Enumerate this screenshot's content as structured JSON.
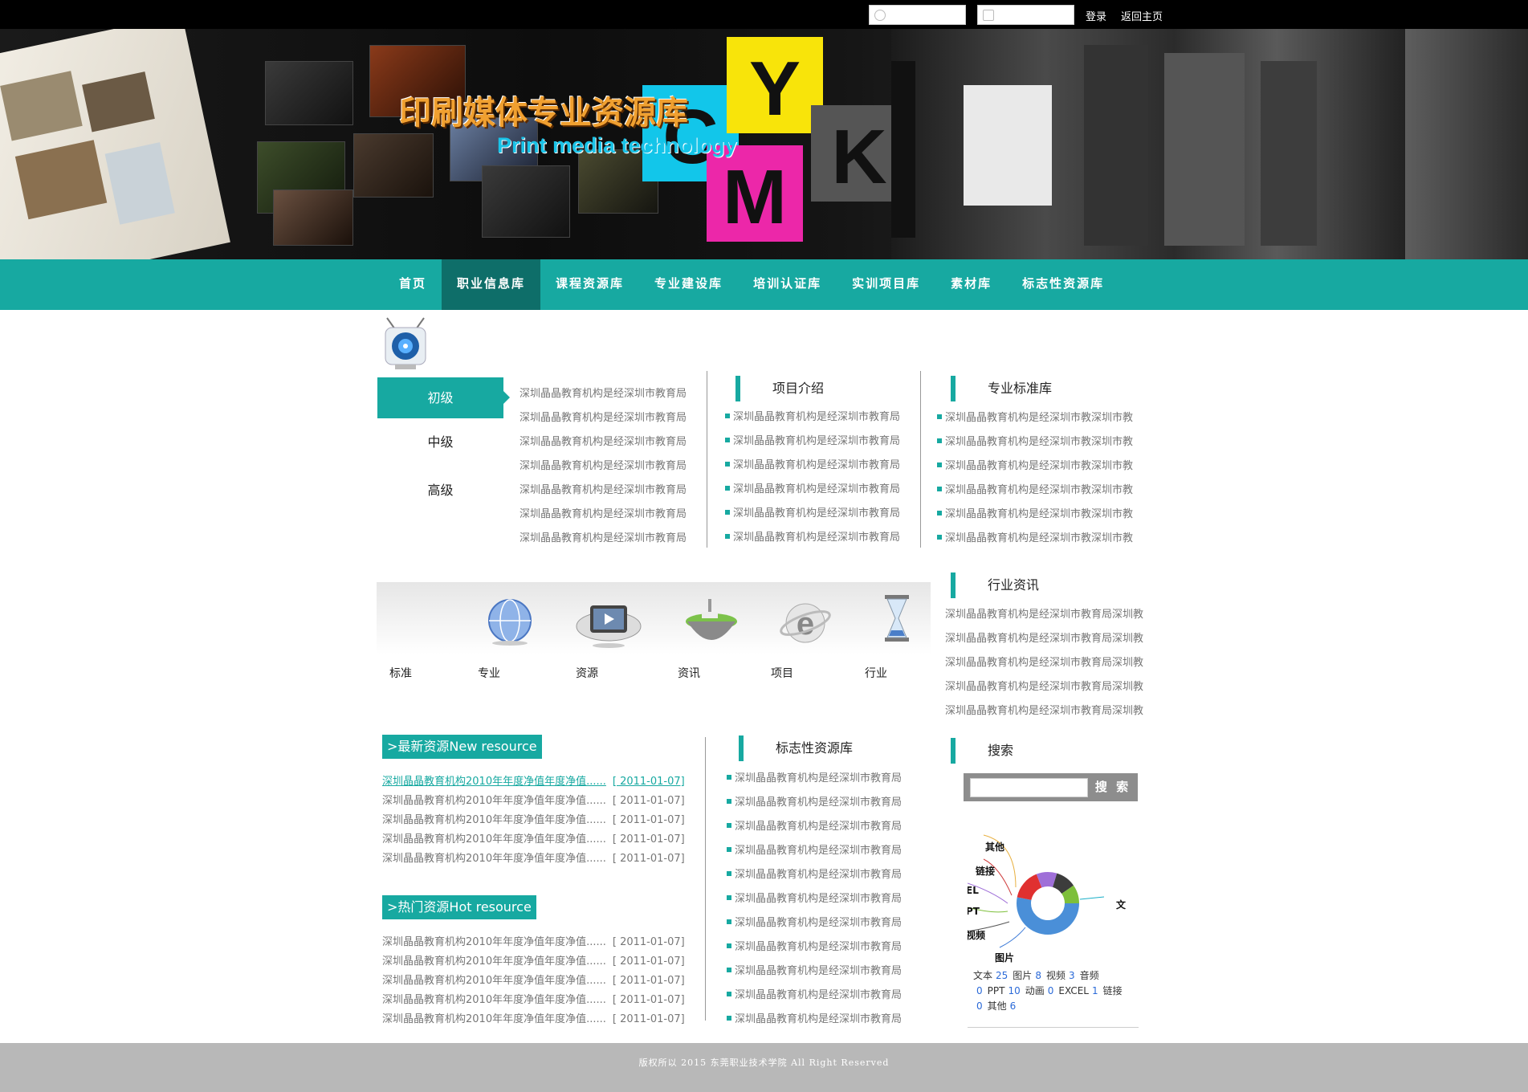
{
  "topbar": {
    "login_label": "登录",
    "home_label": "返回主页",
    "username_icon": "user-icon",
    "password_icon": "lock-icon"
  },
  "banner": {
    "title": "印刷媒体专业资源库",
    "subtitle": "Print media technology",
    "cube_letters": [
      "C",
      "Y",
      "M",
      "K"
    ]
  },
  "nav": {
    "items": [
      "首页",
      "职业信息库",
      "课程资源库",
      "专业建设库",
      "培训认证库",
      "实训项目库",
      "素材库",
      "标志性资源库"
    ],
    "active_index": 1
  },
  "levels": {
    "tabs": [
      "初级",
      "中级",
      "高级"
    ],
    "active_index": 0,
    "items": [
      "深圳晶晶教育机构是经深圳市教育局",
      "深圳晶晶教育机构是经深圳市教育局",
      "深圳晶晶教育机构是经深圳市教育局",
      "深圳晶晶教育机构是经深圳市教育局",
      "深圳晶晶教育机构是经深圳市教育局",
      "深圳晶晶教育机构是经深圳市教育局",
      "深圳晶晶教育机构是经深圳市教育局"
    ]
  },
  "project_intro": {
    "title": "项目介绍",
    "items": [
      "深圳晶晶教育机构是经深圳市教育局",
      "深圳晶晶教育机构是经深圳市教育局",
      "深圳晶晶教育机构是经深圳市教育局",
      "深圳晶晶教育机构是经深圳市教育局",
      "深圳晶晶教育机构是经深圳市教育局",
      "深圳晶晶教育机构是经深圳市教育局"
    ]
  },
  "standards": {
    "title": "专业标准库",
    "items": [
      "深圳晶晶教育机构是经深圳市教深圳市教",
      "深圳晶晶教育机构是经深圳市教深圳市教",
      "深圳晶晶教育机构是经深圳市教深圳市教",
      "深圳晶晶教育机构是经深圳市教深圳市教",
      "深圳晶晶教育机构是经深圳市教深圳市教",
      "深圳晶晶教育机构是经深圳市教深圳市教"
    ]
  },
  "categories": {
    "items": [
      {
        "label": "标准",
        "icon": ""
      },
      {
        "label": "专业",
        "icon": "globe-icon"
      },
      {
        "label": "资源",
        "icon": "video-player-icon"
      },
      {
        "label": "资讯",
        "icon": "floating-island-icon"
      },
      {
        "label": "项目",
        "icon": "ie-browser-icon"
      },
      {
        "label": "行业",
        "icon": "hourglass-icon"
      }
    ]
  },
  "industry_news": {
    "title": "行业资讯",
    "items": [
      "深圳晶晶教育机构是经深圳市教育局深圳教",
      "深圳晶晶教育机构是经深圳市教育局深圳教",
      "深圳晶晶教育机构是经深圳市教育局深圳教",
      "深圳晶晶教育机构是经深圳市教育局深圳教",
      "深圳晶晶教育机构是经深圳市教育局深圳教"
    ]
  },
  "new_resources": {
    "title": ">最新资源New resource",
    "rows": [
      {
        "text": "深圳晶晶教育机构2010年年度净值年度净值......",
        "date": "[ 2011-01-07]"
      },
      {
        "text": "深圳晶晶教育机构2010年年度净值年度净值......",
        "date": "[ 2011-01-07]"
      },
      {
        "text": "深圳晶晶教育机构2010年年度净值年度净值......",
        "date": "[ 2011-01-07]"
      },
      {
        "text": "深圳晶晶教育机构2010年年度净值年度净值......",
        "date": "[ 2011-01-07]"
      },
      {
        "text": "深圳晶晶教育机构2010年年度净值年度净值......",
        "date": "[ 2011-01-07]"
      }
    ]
  },
  "hot_resources": {
    "title": ">热门资源Hot resource",
    "rows": [
      {
        "text": "深圳晶晶教育机构2010年年度净值年度净值......",
        "date": "[ 2011-01-07]"
      },
      {
        "text": "深圳晶晶教育机构2010年年度净值年度净值......",
        "date": "[ 2011-01-07]"
      },
      {
        "text": "深圳晶晶教育机构2010年年度净值年度净值......",
        "date": "[ 2011-01-07]"
      },
      {
        "text": "深圳晶晶教育机构2010年年度净值年度净值......",
        "date": "[ 2011-01-07]"
      },
      {
        "text": "深圳晶晶教育机构2010年年度净值年度净值......",
        "date": "[ 2011-01-07]"
      }
    ]
  },
  "landmark": {
    "title": "标志性资源库",
    "items": [
      "深圳晶晶教育机构是经深圳市教育局",
      "深圳晶晶教育机构是经深圳市教育局",
      "深圳晶晶教育机构是经深圳市教育局",
      "深圳晶晶教育机构是经深圳市教育局",
      "深圳晶晶教育机构是经深圳市教育局",
      "深圳晶晶教育机构是经深圳市教育局",
      "深圳晶晶教育机构是经深圳市教育局",
      "深圳晶晶教育机构是经深圳市教育局",
      "深圳晶晶教育机构是经深圳市教育局",
      "深圳晶晶教育机构是经深圳市教育局",
      "深圳晶晶教育机构是经深圳市教育局"
    ]
  },
  "search": {
    "title": "搜索",
    "button_label": "搜 索",
    "query": ""
  },
  "stats": {
    "labels": {
      "other": "其他",
      "link": "链接",
      "excel": "EL",
      "ppt": "PT",
      "video": "视频",
      "image": "图片",
      "text": "文"
    },
    "counts": [
      {
        "label": "文本",
        "value": "25"
      },
      {
        "label": "图片",
        "value": "8"
      },
      {
        "label": "视频",
        "value": "3"
      },
      {
        "label": "音频",
        "value": "0"
      },
      {
        "label": "PPT",
        "value": "10"
      },
      {
        "label": "动画",
        "value": "0"
      },
      {
        "label": "EXCEL",
        "value": "1"
      },
      {
        "label": "链接",
        "value": "0"
      },
      {
        "label": "其他",
        "value": "6"
      }
    ],
    "colors": [
      "#4a8fd8",
      "#e03030",
      "#f4b400",
      "#3c3c3c",
      "#7dbf3a",
      "#1ab0c8",
      "#8f5bd0"
    ]
  },
  "footer": {
    "text": "版权所以  2015  东莞职业技术学院  All Right Reserved"
  },
  "theme": {
    "accent": "#17a9a1",
    "accent_dark": "#0e6e69",
    "footer_bg": "#b8b8b8"
  }
}
